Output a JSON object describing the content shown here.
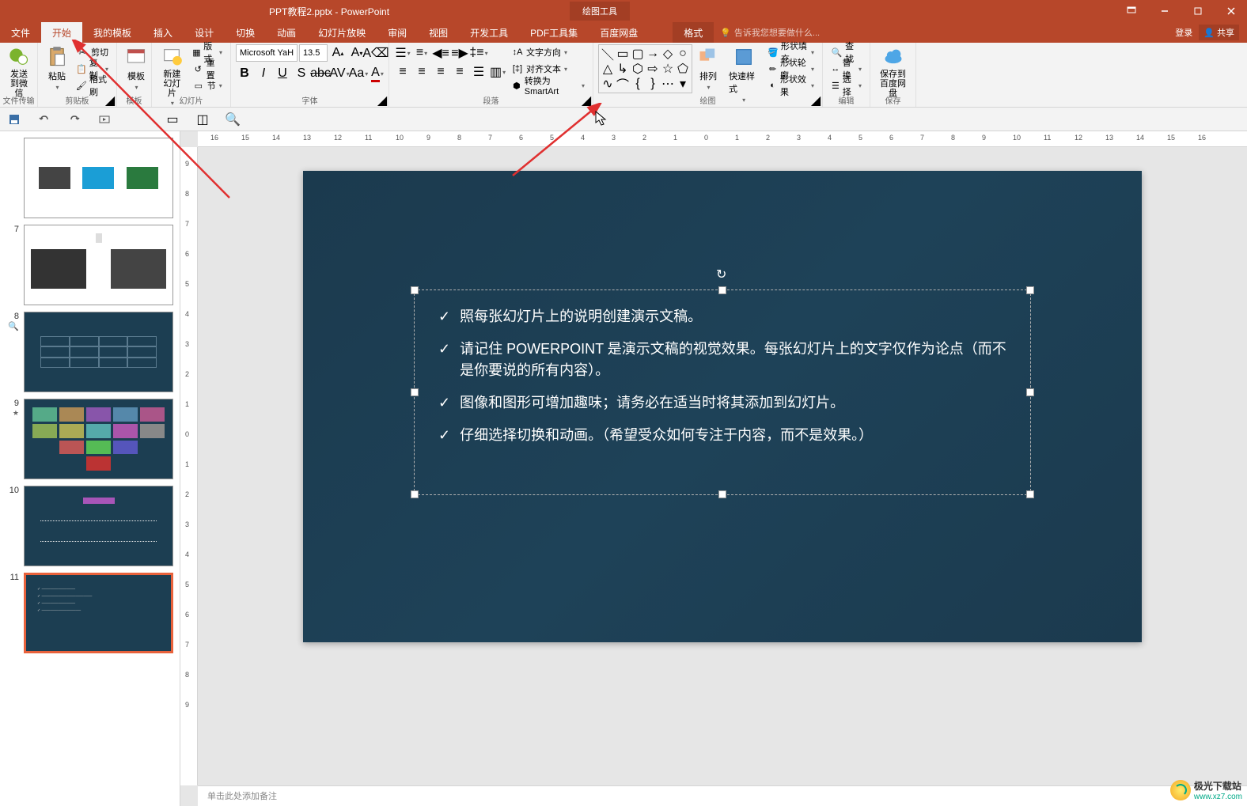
{
  "titlebar": {
    "filename": "PPT教程2.pptx - PowerPoint",
    "tools_tab": "绘图工具",
    "login": "登录",
    "share": "共享"
  },
  "menu": {
    "file": "文件",
    "home": "开始",
    "mytemplate": "我的模板",
    "insert": "插入",
    "design": "设计",
    "transition": "切换",
    "animation": "动画",
    "slideshow": "幻灯片放映",
    "review": "审阅",
    "view": "视图",
    "developer": "开发工具",
    "pdf": "PDF工具集",
    "baidu": "百度网盘",
    "format": "格式",
    "tellme": "告诉我您想要做什么..."
  },
  "ribbon": {
    "filetransfer_label": "文件传输",
    "wechat": "发送\n到微信",
    "clipboard_label": "剪贴板",
    "paste": "粘贴",
    "cut": "剪切",
    "copy": "复制",
    "formatpainter": "格式刷",
    "template_label": "模板",
    "template": "模板",
    "slides_label": "幻灯片",
    "newslide": "新建\n幻灯片",
    "layout": "版式",
    "reset": "重置",
    "section": "节",
    "font_label": "字体",
    "font_name": "Microsoft YaH",
    "font_size": "13.5",
    "paragraph_label": "段落",
    "text_direction": "文字方向",
    "align_text": "对齐文本",
    "smartart": "转换为 SmartArt",
    "drawing_label": "绘图",
    "arrange": "排列",
    "quickstyle": "快速样式",
    "shape_fill": "形状填充",
    "shape_outline": "形状轮廓",
    "shape_effect": "形状效果",
    "editing_label": "编辑",
    "find": "查找",
    "replace": "替换",
    "select": "选择",
    "save_label": "保存",
    "savebaidu": "保存到\n百度网盘"
  },
  "slides": {
    "n7": "7",
    "n8": "8",
    "n9": "9",
    "n10": "10",
    "n11": "11"
  },
  "content": {
    "b1": "照每张幻灯片上的说明创建演示文稿。",
    "b2": "请记住 POWERPOINT 是演示文稿的视觉效果。每张幻灯片上的文字仅作为论点（而不是你要说的所有内容）。",
    "b3": "图像和图形可增加趣味；请务必在适当时将其添加到幻灯片。",
    "b4": "仔细选择切换和动画。（希望受众如何专注于内容，而不是效果。）"
  },
  "notes_placeholder": "单击此处添加备注",
  "watermark": {
    "name": "极光下载站",
    "url": "www.xz7.com"
  }
}
